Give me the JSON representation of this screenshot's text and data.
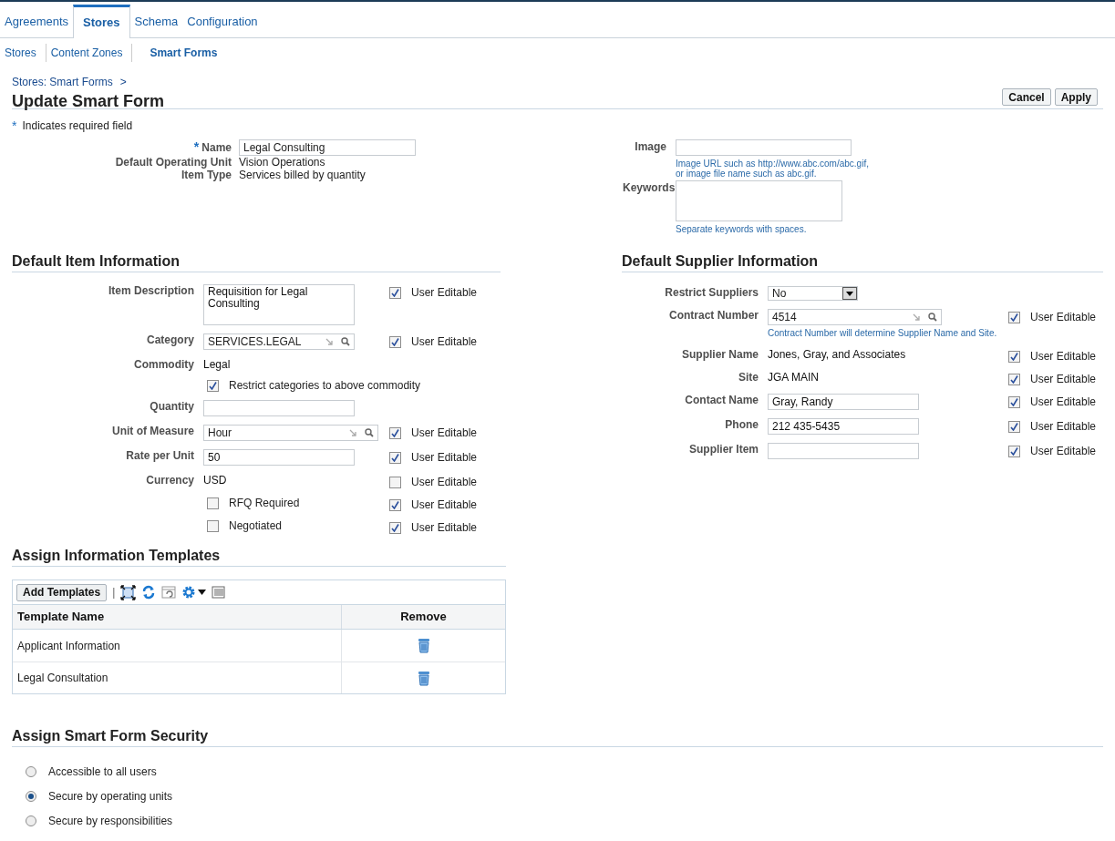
{
  "tabs": [
    {
      "label": "Agreements",
      "selected": false
    },
    {
      "label": "Stores",
      "selected": true
    },
    {
      "label": "Schema",
      "selected": false
    },
    {
      "label": "Configuration",
      "selected": false
    }
  ],
  "subtabs": [
    {
      "label": "Stores",
      "selected": false
    },
    {
      "label": "Content Zones",
      "selected": false
    },
    {
      "label": "Smart Forms",
      "selected": true
    }
  ],
  "breadcrumb": {
    "link": "Stores: Smart Forms",
    "separator": ">"
  },
  "page_title": "Update Smart Form",
  "buttons": [
    "Cancel",
    "Apply"
  ],
  "required_note": {
    "mark": "*",
    "text": "Indicates required field"
  },
  "header_left": [
    {
      "label": "Name",
      "kind": "input",
      "value": "Legal Consulting",
      "required": true,
      "required_mark": "*"
    },
    {
      "label": "Default Operating Unit",
      "kind": "display",
      "value": "Vision Operations"
    },
    {
      "label": "Item Type",
      "kind": "display",
      "value": "Services billed by quantity"
    }
  ],
  "header_right": [
    {
      "label": "Image",
      "kind": "input",
      "hint": "Image URL such as http://www.abc.com/abc.gif,\nor image file name such as abc.gif."
    },
    {
      "label": "Keywords",
      "kind": "textarea",
      "hint": "Separate keywords with spaces."
    }
  ],
  "item_section": {
    "title": "Default Item Information",
    "rows": [
      {
        "kind": "textarea",
        "label": "Item Description",
        "value": "Requisition for Legal Consulting",
        "user_editable": true,
        "editable_label": "User Editable"
      },
      {
        "kind": "lov",
        "label": "Category",
        "value": "SERVICES.LEGAL",
        "user_editable": true,
        "editable_label": "User Editable"
      },
      {
        "kind": "display",
        "label": "Commodity",
        "value": "Legal"
      },
      {
        "kind": "checkbox",
        "label": "Restrict categories to above commodity",
        "checked": true
      },
      {
        "kind": "input",
        "label": "Quantity"
      },
      {
        "kind": "lov_wide",
        "label": "Unit of Measure",
        "value": "Hour",
        "user_editable": true,
        "editable_label": "User Editable"
      },
      {
        "kind": "input",
        "label": "Rate per Unit",
        "value": "50",
        "user_editable": true,
        "editable_label": "User Editable"
      },
      {
        "kind": "display",
        "label": "Currency",
        "value": "USD",
        "user_editable": false,
        "editable_label": "User Editable"
      },
      {
        "kind": "checkbox",
        "label": "RFQ Required",
        "checked": false,
        "user_editable": true,
        "editable_label": "User Editable"
      },
      {
        "kind": "checkbox",
        "label": "Negotiated",
        "checked": false,
        "user_editable": true,
        "editable_label": "User Editable"
      }
    ]
  },
  "supplier_section": {
    "title": "Default Supplier Information",
    "rows": [
      {
        "kind": "select",
        "label": "Restrict Suppliers",
        "value": "No"
      },
      {
        "kind": "lov",
        "label": "Contract Number",
        "value": "4514",
        "hint": "Contract Number will determine Supplier Name and Site.",
        "user_editable": true,
        "editable_label": "User Editable"
      },
      {
        "kind": "display",
        "label": "Supplier Name",
        "value": "Jones, Gray, and Associates",
        "user_editable": true,
        "editable_label": "User Editable"
      },
      {
        "kind": "display",
        "label": "Site",
        "value": "JGA MAIN",
        "user_editable": true,
        "editable_label": "User Editable"
      },
      {
        "kind": "input",
        "label": "Contact Name",
        "value": "Gray, Randy",
        "user_editable": true,
        "editable_label": "User Editable"
      },
      {
        "kind": "input",
        "label": "Phone",
        "value": "212 435-5435",
        "user_editable": true,
        "editable_label": "User Editable"
      },
      {
        "kind": "input",
        "label": "Supplier Item",
        "user_editable": true,
        "editable_label": "User Editable"
      }
    ]
  },
  "templates_section": {
    "title": "Assign Information Templates",
    "add_button": "Add Templates",
    "separator": "|",
    "columns": [
      "Template Name",
      "Remove"
    ],
    "rows": [
      {
        "name": "Applicant Information"
      },
      {
        "name": "Legal Consultation"
      }
    ]
  },
  "security_section": {
    "title": "Assign Smart Form Security",
    "options": [
      {
        "label": "Accessible to all users",
        "selected": false
      },
      {
        "label": "Secure by operating units",
        "selected": true
      },
      {
        "label": "Secure by responsibilities",
        "selected": false
      }
    ]
  }
}
